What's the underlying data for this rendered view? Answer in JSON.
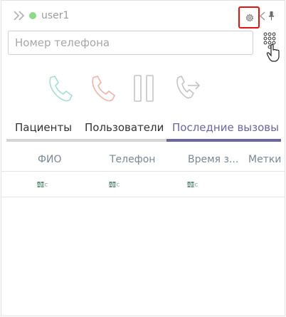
{
  "header": {
    "username": "user1",
    "status_color": "#8fd98a",
    "icons": [
      "expand-chevrons-icon",
      "settings-gear-icon",
      "collapse-chevron-icon",
      "pin-icon"
    ]
  },
  "phone": {
    "placeholder": "Номер телефона",
    "value": ""
  },
  "controls": [
    {
      "name": "call-button",
      "icon": "phone-icon",
      "color": "#a7ddd4"
    },
    {
      "name": "hangup-button",
      "icon": "phone-hangup-icon",
      "color": "#f0b2aa"
    },
    {
      "name": "hold-button",
      "icon": "pause-icon",
      "color": "#c4c4c4"
    },
    {
      "name": "transfer-button",
      "icon": "transfer-icon",
      "color": "#c4c4c4"
    }
  ],
  "tabs": [
    {
      "label": "Пациенты",
      "active": false
    },
    {
      "label": "Пользователи",
      "active": false
    },
    {
      "label": "Последние вызовы",
      "active": true
    }
  ],
  "colors": {
    "accent": "#6b669e",
    "tab_text": "#333333",
    "active_tab_text": "#6b669e",
    "header_text": "#7a8794",
    "cell_icon": "#5f8e7a"
  },
  "table": {
    "columns": [
      "ФИО",
      "Телефон",
      "Время з...",
      "Метки"
    ],
    "filter_row": [
      "text-filter-icon",
      "text-filter-icon",
      "text-filter-icon"
    ]
  }
}
